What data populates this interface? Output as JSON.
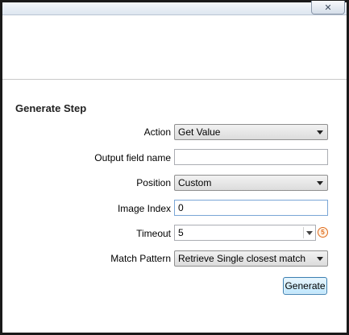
{
  "window": {
    "close_glyph": "✕"
  },
  "section_title": "Generate Step",
  "form": {
    "action": {
      "label": "Action",
      "value": "Get Value"
    },
    "output_field": {
      "label": "Output field name",
      "value": ""
    },
    "position": {
      "label": "Position",
      "value": "Custom"
    },
    "image_index": {
      "label": "Image Index",
      "value": "0"
    },
    "timeout": {
      "label": "Timeout",
      "value": "5",
      "unit_glyph": "5"
    },
    "match_pattern": {
      "label": "Match Pattern",
      "value": "Retrieve Single closest match"
    }
  },
  "buttons": {
    "generate_label": "Generate"
  },
  "icons": {
    "close": "close-icon",
    "dropdown": "chevron-down-icon",
    "timer": "timer-icon"
  },
  "colors": {
    "accent_border": "#3c7fb1",
    "timer_orange": "#e06a1a"
  }
}
